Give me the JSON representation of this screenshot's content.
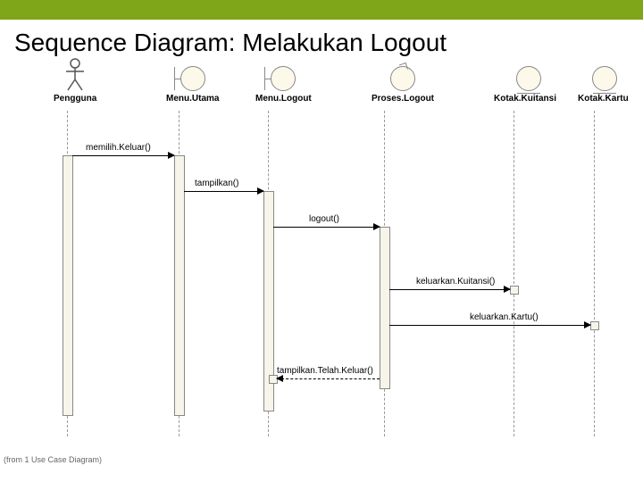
{
  "title": "Sequence Diagram: Melakukan Logout",
  "participants": {
    "p0": "Pengguna",
    "p1": "Menu.Utama",
    "p2": "Menu.Logout",
    "p3": "Proses.Logout",
    "p4": "Kotak.Kuitansi",
    "p5": "Kotak.Kartu"
  },
  "messages": {
    "m0": "memilih.Keluar()",
    "m1": "tampilkan()",
    "m2": "logout()",
    "m3": "keluarkan.Kuitansi()",
    "m4": "keluarkan.Kartu()",
    "m5": "tampilkan.Telah.Keluar()"
  },
  "footnote": "(from 1 Use Case Diagram)",
  "chart_data": {
    "type": "sequence-diagram",
    "participants": [
      {
        "id": "Pengguna",
        "stereotype": "actor"
      },
      {
        "id": "Menu.Utama",
        "stereotype": "boundary"
      },
      {
        "id": "Menu.Logout",
        "stereotype": "boundary"
      },
      {
        "id": "Proses.Logout",
        "stereotype": "control"
      },
      {
        "id": "Kotak.Kuitansi",
        "stereotype": "entity"
      },
      {
        "id": "Kotak.Kartu",
        "stereotype": "entity"
      }
    ],
    "messages": [
      {
        "from": "Pengguna",
        "to": "Menu.Utama",
        "label": "memilih.Keluar()",
        "type": "call"
      },
      {
        "from": "Menu.Utama",
        "to": "Menu.Logout",
        "label": "tampilkan()",
        "type": "call"
      },
      {
        "from": "Menu.Logout",
        "to": "Proses.Logout",
        "label": "logout()",
        "type": "call"
      },
      {
        "from": "Proses.Logout",
        "to": "Kotak.Kuitansi",
        "label": "keluarkan.Kuitansi()",
        "type": "call"
      },
      {
        "from": "Proses.Logout",
        "to": "Kotak.Kartu",
        "label": "keluarkan.Kartu()",
        "type": "call"
      },
      {
        "from": "Proses.Logout",
        "to": "Menu.Logout",
        "label": "tampilkan.Telah.Keluar()",
        "type": "return"
      }
    ]
  }
}
